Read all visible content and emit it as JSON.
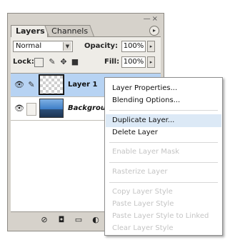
{
  "panel": {
    "window_controls": "—×",
    "tabs": [
      {
        "label": "Layers"
      },
      {
        "label": "Channels"
      }
    ],
    "menu_glyph": "▸",
    "blend_mode": "Normal",
    "opacity_label": "Opacity:",
    "opacity_value": "100%",
    "lock_label": "Lock:",
    "fill_label": "Fill:",
    "fill_value": "100%",
    "layers": [
      {
        "name": "Layer 1",
        "selected": true,
        "thumbnail": "transparent"
      },
      {
        "name": "Background",
        "selected": false,
        "thumbnail": "photo"
      }
    ]
  },
  "context_menu": {
    "items": [
      {
        "label": "Layer Properties...",
        "enabled": true
      },
      {
        "label": "Blending Options...",
        "enabled": true
      },
      {
        "label": "Duplicate Layer...",
        "enabled": true,
        "highlighted": true
      },
      {
        "label": "Delete Layer",
        "enabled": true
      },
      {
        "label": "Enable Layer Mask",
        "enabled": false
      },
      {
        "label": "Rasterize Layer",
        "enabled": false
      },
      {
        "label": "Copy Layer Style",
        "enabled": false
      },
      {
        "label": "Paste Layer Style",
        "enabled": false
      },
      {
        "label": "Paste Layer Style to Linked",
        "enabled": false
      },
      {
        "label": "Clear Layer Style",
        "enabled": false
      }
    ]
  },
  "icons": {
    "eye": "eye-icon",
    "brush": "brush-icon",
    "lock_transparent": "lock-transparency-icon",
    "lock_paint": "lock-paint-icon",
    "lock_move": "lock-move-icon",
    "lock_all": "lock-all-icon"
  },
  "colors": {
    "panel_bg": "#d6d2cb",
    "selection": "#b7d3f3",
    "menu_highlight": "#dce9f6",
    "disabled_text": "#c4c4c4"
  }
}
